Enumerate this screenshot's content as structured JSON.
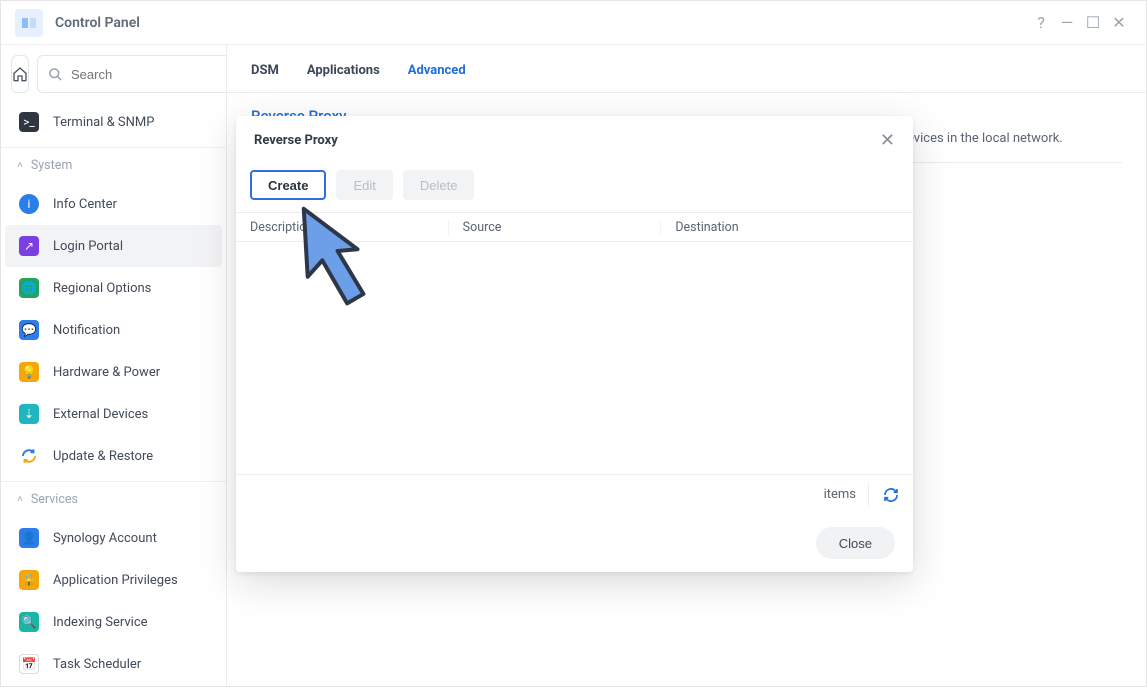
{
  "window": {
    "title": "Control Panel"
  },
  "search": {
    "placeholder": "Search"
  },
  "sidebar": {
    "terminal": "Terminal & SNMP",
    "groups": [
      {
        "name": "System",
        "items": [
          {
            "label": "Info Center"
          },
          {
            "label": "Login Portal"
          },
          {
            "label": "Regional Options"
          },
          {
            "label": "Notification"
          },
          {
            "label": "Hardware & Power"
          },
          {
            "label": "External Devices"
          },
          {
            "label": "Update & Restore"
          }
        ]
      },
      {
        "name": "Services",
        "items": [
          {
            "label": "Synology Account"
          },
          {
            "label": "Application Privileges"
          },
          {
            "label": "Indexing Service"
          },
          {
            "label": "Task Scheduler"
          }
        ]
      }
    ]
  },
  "tabs": {
    "dsm": "DSM",
    "apps": "Applications",
    "adv": "Advanced",
    "active": "adv"
  },
  "page": {
    "section_title": "Reverse Proxy",
    "section_desc_suffix": "evices in the local network."
  },
  "modal": {
    "title": "Reverse Proxy",
    "buttons": {
      "create": "Create",
      "edit": "Edit",
      "delete": "Delete",
      "close": "Close"
    },
    "columns": {
      "desc": "Description",
      "source": "Source",
      "dest": "Destination"
    },
    "status_items": "items"
  }
}
